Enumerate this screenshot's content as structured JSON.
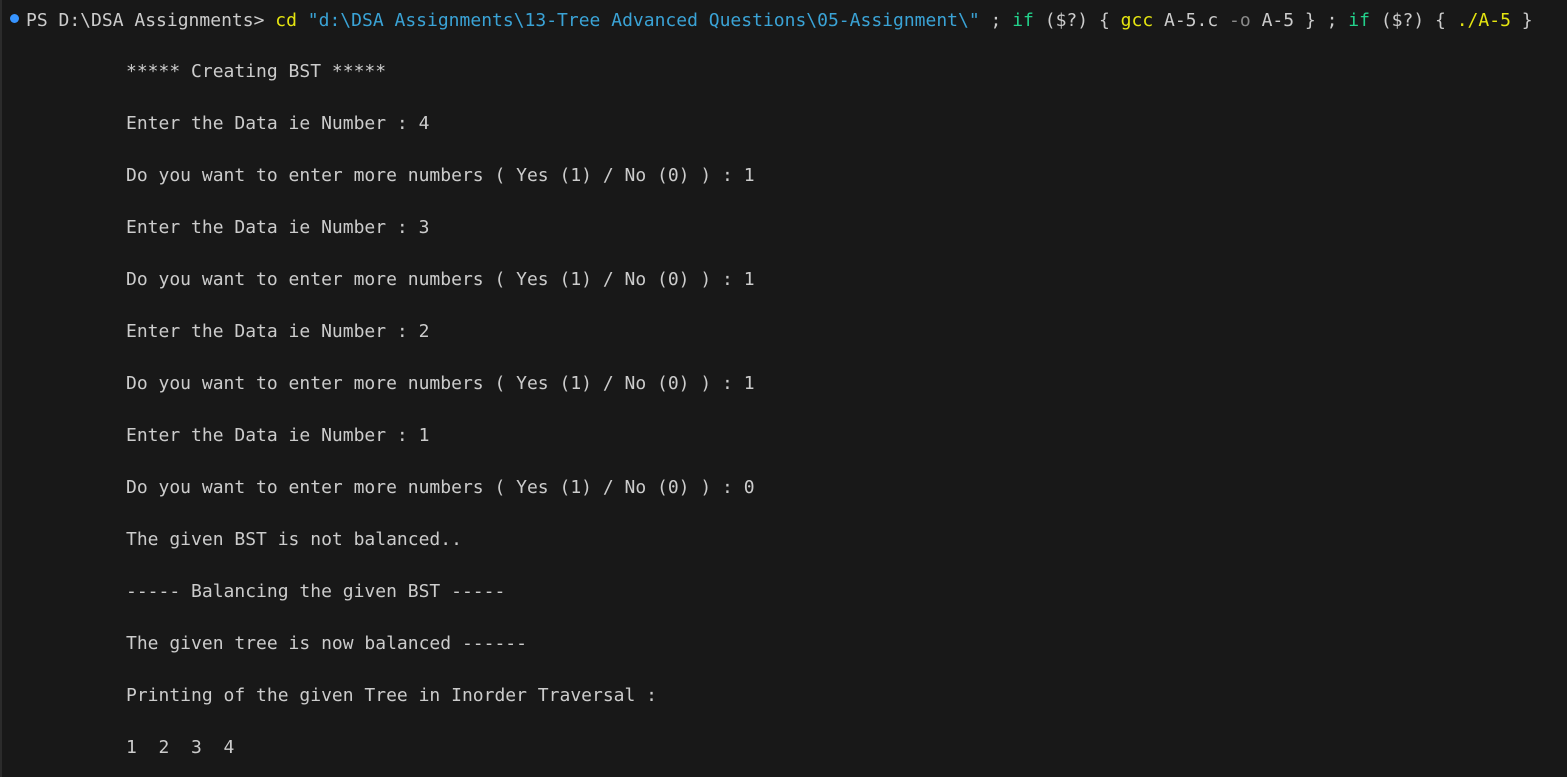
{
  "terminal": {
    "prompt": "PS D:\\DSA Assignments>",
    "command": {
      "cd": "cd",
      "path": "\"d:\\DSA Assignments\\13-Tree Advanced Questions\\05-Assignment\\\"",
      "sep1": ";",
      "if1": "if",
      "cond1": "($?)",
      "brace_open1": "{",
      "gcc": "gcc",
      "src": "A-5.c",
      "flag": "-o",
      "out": "A-5",
      "brace_close1": "}",
      "sep2": ";",
      "if2": "if",
      "cond2": "($?)",
      "brace_open2": "{",
      "run": "./A-5",
      "brace_close2": "}"
    },
    "output_lines": [
      "***** Creating BST *****",
      "Enter the Data ie Number : 4",
      "Do you want to enter more numbers ( Yes (1) / No (0) ) : 1",
      "Enter the Data ie Number : 3",
      "Do you want to enter more numbers ( Yes (1) / No (0) ) : 1",
      "Enter the Data ie Number : 2",
      "Do you want to enter more numbers ( Yes (1) / No (0) ) : 1",
      "Enter the Data ie Number : 1",
      "Do you want to enter more numbers ( Yes (1) / No (0) ) : 0",
      "The given BST is not balanced..",
      "----- Balancing the given BST -----",
      "The given tree is now balanced ------",
      "Printing of the given Tree in Inorder Traversal :",
      "1  2  3  4"
    ]
  },
  "colors": {
    "background": "#181818",
    "text": "#cccccc",
    "keyword_yellow": "#e5e510",
    "string_cyan": "#3aa3d6",
    "keyword_green": "#23d18b",
    "flag_gray": "#8a8a8a",
    "status_dot": "#3794ff"
  }
}
